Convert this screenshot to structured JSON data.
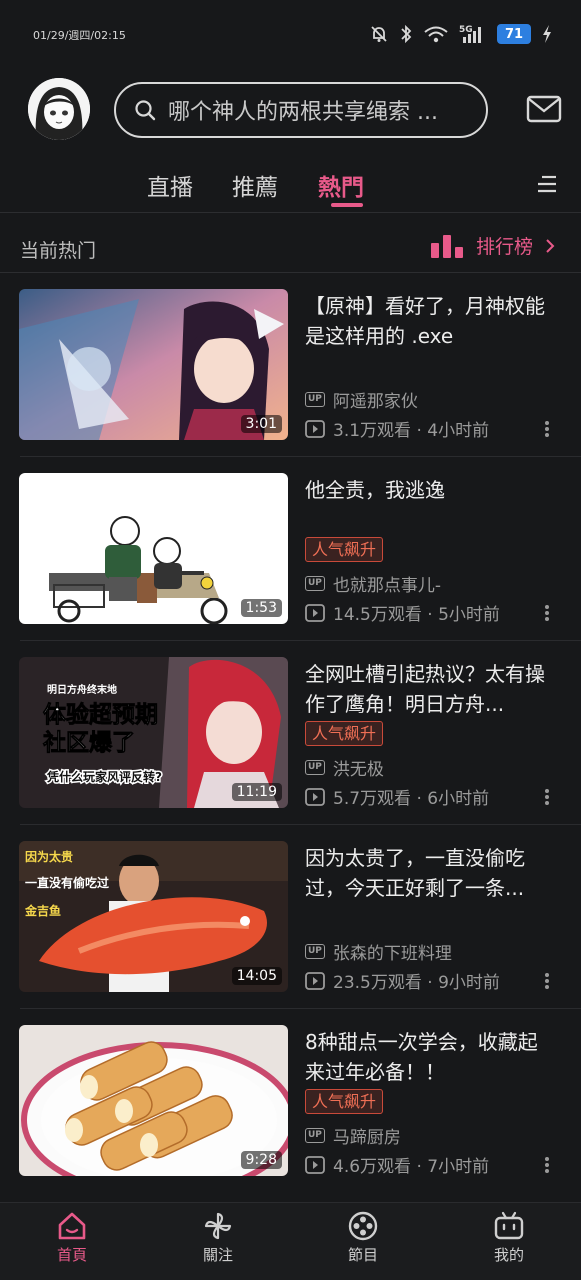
{
  "status_bar": {
    "time": "01/29/週四/02:15",
    "battery": "71",
    "network": "5G"
  },
  "search": {
    "placeholder": "哪个神人的两根共享绳索 ..."
  },
  "tabs": [
    {
      "label": "直播",
      "active": false
    },
    {
      "label": "推薦",
      "active": false
    },
    {
      "label": "熱門",
      "active": true
    }
  ],
  "section": {
    "title": "当前热门",
    "ranking_label": "排行榜"
  },
  "videos": [
    {
      "title": "【原神】看好了，月神权能是这样用的 .exe",
      "badge": "",
      "author": "阿遥那家伙",
      "stats": "3.1万观看 · 4小时前",
      "duration": "3:01"
    },
    {
      "title": "他全责，我逃逸",
      "badge": "人气飙升",
      "author": "也就那点事儿-",
      "stats": "14.5万观看 · 5小时前",
      "duration": "1:53"
    },
    {
      "title": "全网吐槽引起热议？太有操作了鹰角！明日方舟...",
      "badge": "人气飙升",
      "author": "洪无极",
      "stats": "5.7万观看 · 6小时前",
      "duration": "11:19",
      "thumb_text": [
        "明日方舟终末地",
        "体验超预期",
        "社区爆了",
        "凭什么玩家风评反转?"
      ]
    },
    {
      "title": "因为太贵了，一直没偷吃过，今天正好剩了一条...",
      "badge": "",
      "author": "张森的下班料理",
      "stats": "23.5万观看 · 9小时前",
      "duration": "14:05",
      "thumb_text": [
        "因为太贵",
        "一直没有偷吃过",
        "金吉鱼"
      ]
    },
    {
      "title": "8种甜点一次学会，收藏起来过年必备！！",
      "badge": "人气飙升",
      "author": "马蹄厨房",
      "stats": "4.6万观看 · 7小时前",
      "duration": "9:28"
    }
  ],
  "bottom_nav": [
    {
      "label": "首頁",
      "icon": "home-icon",
      "active": true
    },
    {
      "label": "關注",
      "icon": "pinwheel-icon",
      "active": false
    },
    {
      "label": "節目",
      "icon": "film-reel-icon",
      "active": false
    },
    {
      "label": "我的",
      "icon": "tv-face-icon",
      "active": false
    }
  ],
  "colors": {
    "background": "#17181a",
    "accent": "#e85a8a",
    "badge": "#ef6f55"
  }
}
